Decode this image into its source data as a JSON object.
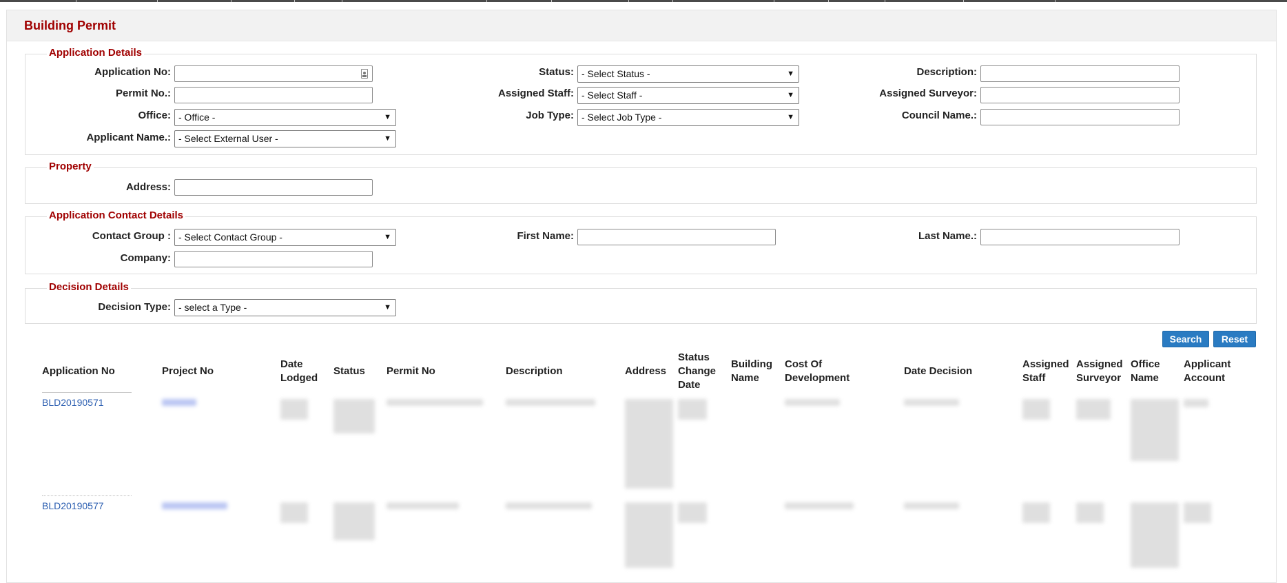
{
  "title": "Building Permit",
  "sections": {
    "application_details": {
      "legend": "Application Details",
      "application_no_label": "Application No:",
      "application_no_value": "",
      "permit_no_label": "Permit No.:",
      "permit_no_value": "",
      "office_label": "Office:",
      "office_selected": "- Office -",
      "applicant_name_label": "Applicant Name.:",
      "applicant_name_selected": "- Select External User -",
      "status_label": "Status:",
      "status_selected": "- Select Status -",
      "assigned_staff_label": "Assigned Staff:",
      "assigned_staff_selected": "- Select Staff -",
      "job_type_label": "Job Type:",
      "job_type_selected": "- Select Job Type -",
      "description_label": "Description:",
      "description_value": "",
      "assigned_surveyor_label": "Assigned Surveyor:",
      "assigned_surveyor_value": "",
      "council_name_label": "Council Name.:",
      "council_name_value": ""
    },
    "property": {
      "legend": "Property",
      "address_label": "Address:",
      "address_value": ""
    },
    "contact_details": {
      "legend": "Application Contact Details",
      "contact_group_label": "Contact Group :",
      "contact_group_selected": "- Select Contact Group -",
      "company_label": "Company:",
      "company_value": "",
      "first_name_label": "First Name:",
      "first_name_value": "",
      "last_name_label": "Last Name.:",
      "last_name_value": ""
    },
    "decision_details": {
      "legend": "Decision Details",
      "decision_type_label": "Decision Type:",
      "decision_type_selected": "- select a Type -"
    }
  },
  "buttons": {
    "search": "Search",
    "reset": "Reset"
  },
  "table": {
    "columns": [
      "Application No",
      "Project No",
      "Date Lodged",
      "Status",
      "Permit No",
      "Description",
      "Address",
      "Status Change Date",
      "Building Name",
      "Cost Of Development",
      "Date Decision",
      "Assigned Staff",
      "Assigned Surveyor",
      "Office Name",
      "Applicant Account"
    ],
    "rows": [
      {
        "application_no": "BLD20190571"
      },
      {
        "application_no": "BLD20190577"
      }
    ]
  },
  "icons": {
    "application_no_field": "contact-card-icon",
    "select_arrow": "dropdown-arrow-icon"
  },
  "colors": {
    "title": "#a00000",
    "button": "#2a7bc2",
    "link": "#2a5db0"
  }
}
